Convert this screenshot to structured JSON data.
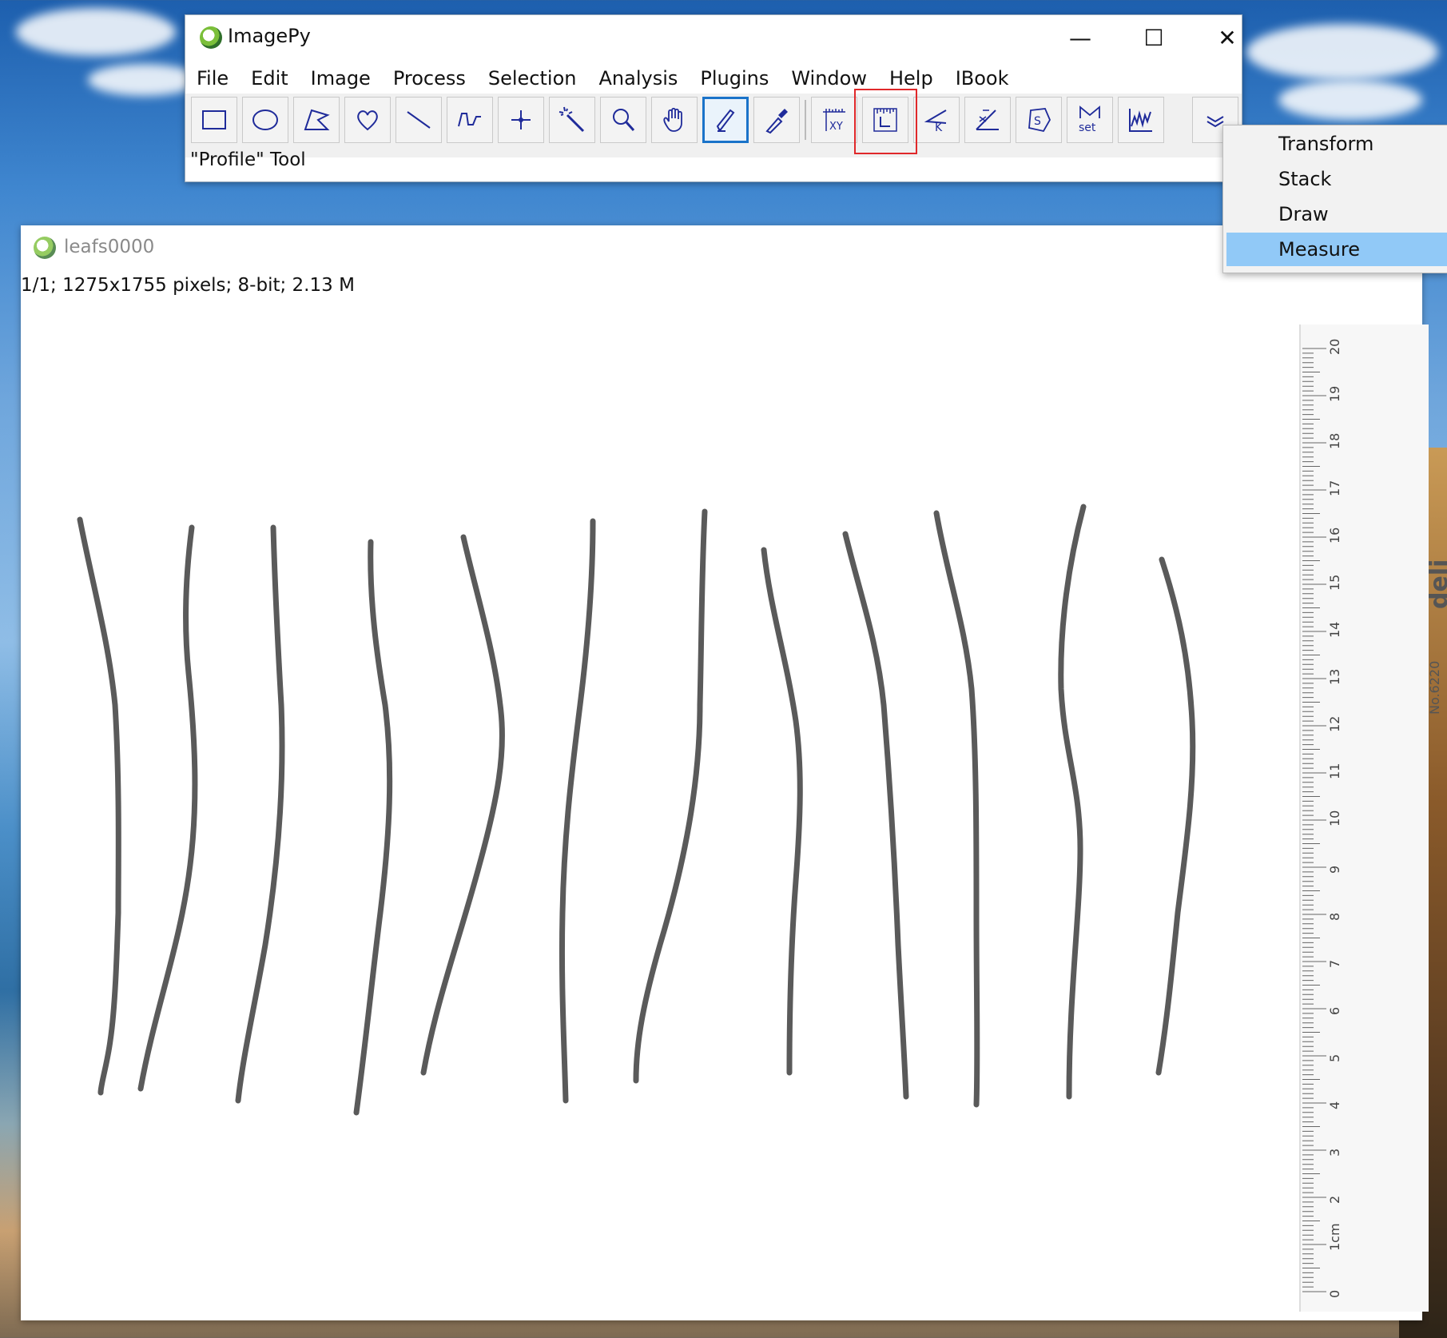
{
  "app": {
    "title": "ImagePy",
    "window_controls": {
      "minimize": "—",
      "maximize": "☐",
      "close": "✕"
    }
  },
  "menubar": {
    "items": [
      "File",
      "Edit",
      "Image",
      "Process",
      "Selection",
      "Analysis",
      "Plugins",
      "Window",
      "Help",
      "IBook"
    ]
  },
  "toolbar": {
    "tools": [
      {
        "name": "rectangle-tool",
        "icon": "rectangle-icon"
      },
      {
        "name": "ellipse-tool",
        "icon": "ellipse-icon"
      },
      {
        "name": "polygon-tool",
        "icon": "polygon-icon"
      },
      {
        "name": "freehand-tool",
        "icon": "heart-icon"
      },
      {
        "name": "line-tool",
        "icon": "line-icon"
      },
      {
        "name": "polyline-tool",
        "icon": "polyline-icon"
      },
      {
        "name": "point-tool",
        "icon": "crosshair-icon"
      },
      {
        "name": "wand-tool",
        "icon": "magic-wand-icon"
      },
      {
        "name": "zoom-tool",
        "icon": "magnifier-icon"
      },
      {
        "name": "hand-tool",
        "icon": "hand-icon"
      },
      {
        "name": "pencil-tool",
        "icon": "pencil-icon",
        "active": true
      },
      {
        "name": "picker-tool",
        "icon": "dropper-icon"
      },
      {
        "name": "coordinate-tool",
        "icon": "xy-ruler-icon"
      },
      {
        "name": "length-tool",
        "icon": "ruler-l-icon",
        "highlighted": true
      },
      {
        "name": "angle-tool",
        "icon": "angle-k-icon"
      },
      {
        "name": "slope-tool",
        "icon": "angle-x-icon"
      },
      {
        "name": "area-tool",
        "icon": "area-s-icon"
      },
      {
        "name": "setscale-tool",
        "icon": "set-scale-icon"
      },
      {
        "name": "profile-tool",
        "icon": "profile-icon"
      }
    ],
    "more_icon": "chevron-down-icon",
    "set_label": "set"
  },
  "status": {
    "text": "\"Profile\" Tool"
  },
  "dropdown": {
    "items": [
      {
        "label": "Transform",
        "selected": false
      },
      {
        "label": "Stack",
        "selected": false
      },
      {
        "label": "Draw",
        "selected": false
      },
      {
        "label": "Measure",
        "selected": true
      }
    ]
  },
  "image_window": {
    "title": "leafs0000",
    "info": "1/1;   1275x1755 pixels; 8-bit; 2.13 M"
  },
  "ruler": {
    "brand": "deli得力",
    "model": "No.6220",
    "labels": [
      "20",
      "19",
      "18",
      "17",
      "16",
      "15",
      "14",
      "13",
      "12",
      "11",
      "10",
      "9",
      "8",
      "7",
      "6",
      "5",
      "4",
      "3",
      "2",
      "1cm",
      "0"
    ]
  },
  "colors": {
    "accent": "#1a73c9",
    "highlight": "#e0282a",
    "menu_selected": "#91c9f7",
    "tool_icon": "#1f2b9a"
  }
}
